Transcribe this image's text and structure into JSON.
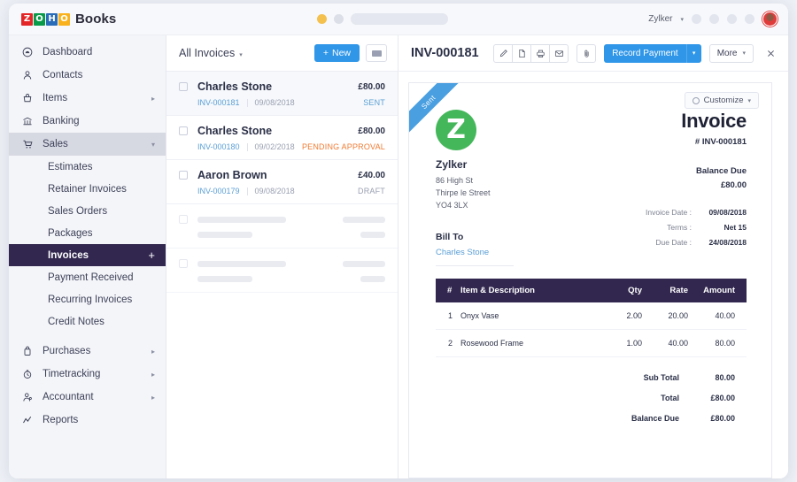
{
  "topbar": {
    "logo_tiles": [
      "Z",
      "O",
      "H",
      "O"
    ],
    "logo_text": "Books",
    "org_name": "Zylker",
    "org_caret": "▾"
  },
  "sidebar": {
    "items": [
      {
        "label": "Dashboard",
        "icon": "dashboard-icon",
        "arrow": ""
      },
      {
        "label": "Contacts",
        "icon": "contacts-icon",
        "arrow": ""
      },
      {
        "label": "Items",
        "icon": "items-icon",
        "arrow": "▸"
      },
      {
        "label": "Banking",
        "icon": "banking-icon",
        "arrow": ""
      },
      {
        "label": "Sales",
        "icon": "sales-icon",
        "arrow": "▾"
      }
    ],
    "sales_children": [
      {
        "label": "Estimates"
      },
      {
        "label": "Retainer Invoices"
      },
      {
        "label": "Sales Orders"
      },
      {
        "label": "Packages"
      },
      {
        "label": "Invoices",
        "active": true,
        "plus": "+"
      },
      {
        "label": "Payment Received"
      },
      {
        "label": "Recurring Invoices"
      },
      {
        "label": "Credit Notes"
      }
    ],
    "items_bottom": [
      {
        "label": "Purchases",
        "icon": "purchases-icon",
        "arrow": "▸"
      },
      {
        "label": "Timetracking",
        "icon": "timetracking-icon",
        "arrow": "▸"
      },
      {
        "label": "Accountant",
        "icon": "accountant-icon",
        "arrow": "▸"
      },
      {
        "label": "Reports",
        "icon": "reports-icon",
        "arrow": ""
      }
    ]
  },
  "list": {
    "title": "All Invoices",
    "title_caret": "▾",
    "new_label": "New",
    "new_plus": "+",
    "rows": [
      {
        "name": "Charles Stone",
        "amount": "£80.00",
        "number": "INV-000181",
        "date": "09/08/2018",
        "status": "SENT",
        "status_kind": "sent",
        "selected": true
      },
      {
        "name": "Charles Stone",
        "amount": "£80.00",
        "number": "INV-000180",
        "date": "09/02/2018",
        "status": "PENDING APPROVAL",
        "status_kind": "pending",
        "selected": false
      },
      {
        "name": "Aaron Brown",
        "amount": "£40.00",
        "number": "INV-000179",
        "date": "09/08/2018",
        "status": "DRAFT",
        "status_kind": "draft",
        "selected": false
      }
    ]
  },
  "detail": {
    "title": "INV-000181",
    "toolbar": {
      "edit": "edit-icon",
      "pdf": "pdf-icon",
      "print": "print-icon",
      "email": "email-icon",
      "attach": "paperclip-icon",
      "record_payment_label": "Record Payment",
      "record_payment_caret": "▾",
      "more_label": "More",
      "more_caret": "▾",
      "close": "×"
    },
    "ribbon": "Sent",
    "customize_label": "Customize",
    "customize_caret": "▾",
    "org": {
      "logo_letter": "Z",
      "name": "Zylker",
      "address_lines": [
        "86 High St",
        "Thirpe le Street",
        "YO4 3LX"
      ]
    },
    "bill_to_label": "Bill To",
    "bill_to_name": "Charles Stone",
    "heading": "Invoice",
    "number_label": "# INV-000181",
    "balance_due_label": "Balance Due",
    "balance_due_value": "£80.00",
    "meta": [
      {
        "key": "Invoice Date :",
        "value": "09/08/2018"
      },
      {
        "key": "Terms :",
        "value": "Net 15"
      },
      {
        "key": "Due Date :",
        "value": "24/08/2018"
      }
    ],
    "table": {
      "headers": [
        "#",
        "Item & Description",
        "Qty",
        "Rate",
        "Amount"
      ],
      "rows": [
        {
          "num": "1",
          "item": "Onyx Vase",
          "qty": "2.00",
          "rate": "20.00",
          "amount": "40.00"
        },
        {
          "num": "2",
          "item": "Rosewood Frame",
          "qty": "1.00",
          "rate": "40.00",
          "amount": "80.00"
        }
      ]
    },
    "totals": [
      {
        "key": "Sub Total",
        "value": "80.00"
      },
      {
        "key": "Total",
        "value": "£80.00"
      },
      {
        "key": "Balance Due",
        "value": "£80.00"
      }
    ]
  },
  "colors": {
    "accent_blue": "#2f96e8",
    "dark_purple": "#32274f",
    "status_sent": "#5b9fd6",
    "status_pending": "#f07b33",
    "status_draft": "#9aa0b2",
    "brand_green": "#45b75b"
  }
}
